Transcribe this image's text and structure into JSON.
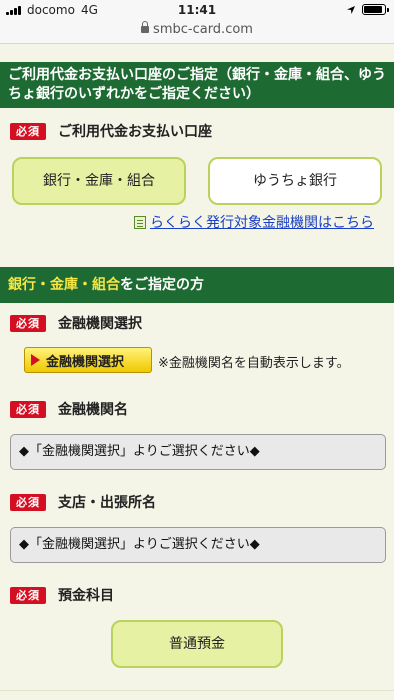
{
  "status": {
    "carrier": "docomo",
    "network": "4G",
    "time": "11:41",
    "battery_level": 0.9
  },
  "browser": {
    "url": "smbc-card.com"
  },
  "header1": {
    "title": "ご利用代金お支払い口座のご指定（銀行・金庫・組合、ゆうちょ銀行のいずれかをご指定ください）"
  },
  "required_badge": "必須",
  "account_section": {
    "label": "ご利用代金お支払い口座",
    "options": [
      "銀行・金庫・組合",
      "ゆうちょ銀行"
    ],
    "selected": "銀行・金庫・組合",
    "link_text": "らくらく発行対象金融機関はこちら"
  },
  "header2": {
    "highlight": "銀行・金庫・組合",
    "rest": "をご指定の方"
  },
  "bank_select": {
    "label": "金融機関選択",
    "button_label": "金融機関選択",
    "note": "※金融機関名を自動表示します。"
  },
  "bank_name": {
    "label": "金融機関名",
    "value": "◆「金融機関選択」よりご選択ください◆"
  },
  "branch_name": {
    "label": "支店・出張所名",
    "value": "◆「金融機関選択」よりご選択ください◆"
  },
  "deposit_type": {
    "label": "預金科目",
    "value": "普通預金"
  },
  "colors": {
    "header_green": "#1e6a33",
    "highlight_yellow": "#f5e642",
    "required_red": "#d50f22",
    "option_border": "#b9d25d",
    "option_selected_bg": "#e7f1a4",
    "page_bg": "#f4f5e6",
    "link_blue": "#1a3fc4"
  }
}
